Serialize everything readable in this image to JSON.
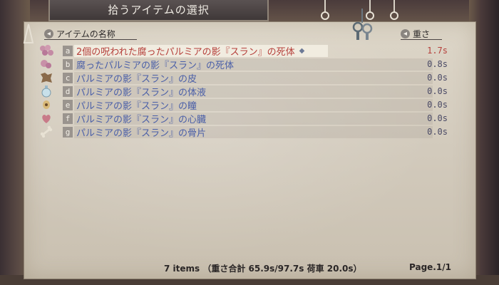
{
  "window": {
    "title": "拾うアイテムの選択"
  },
  "columns": {
    "name_header": "アイテムの名称",
    "weight_header": "重さ"
  },
  "items": [
    {
      "key": "a",
      "icon": "meat-chunks-icon",
      "name": "2個の呪われた腐ったパルミアの影『スラン』の死体",
      "weight": "1.7s",
      "selected": true
    },
    {
      "key": "b",
      "icon": "meat-chunk-icon",
      "name": "腐ったパルミアの影『スラン』の死体",
      "weight": "0.8s",
      "selected": false
    },
    {
      "key": "c",
      "icon": "hide-icon",
      "name": "パルミアの影『スラン』の皮",
      "weight": "0.0s",
      "selected": false
    },
    {
      "key": "d",
      "icon": "potion-flask-icon",
      "name": "パルミアの影『スラン』の体液",
      "weight": "0.0s",
      "selected": false
    },
    {
      "key": "e",
      "icon": "eyeball-icon",
      "name": "パルミアの影『スラン』の瞳",
      "weight": "0.0s",
      "selected": false
    },
    {
      "key": "f",
      "icon": "heart-icon",
      "name": "パルミアの影『スラン』の心臓",
      "weight": "0.0s",
      "selected": false
    },
    {
      "key": "g",
      "icon": "bone-icon",
      "name": "パルミアの影『スラン』の骨片",
      "weight": "0.0s",
      "selected": false
    }
  ],
  "footer": {
    "summary": "7 items （重さ合計 65.9s/97.7s 荷車 20.0s）",
    "page": "Page.1/1"
  },
  "colors": {
    "selected_text": "#b5403b",
    "item_text": "#4a5fa8",
    "title_bg": "#4a4242"
  }
}
